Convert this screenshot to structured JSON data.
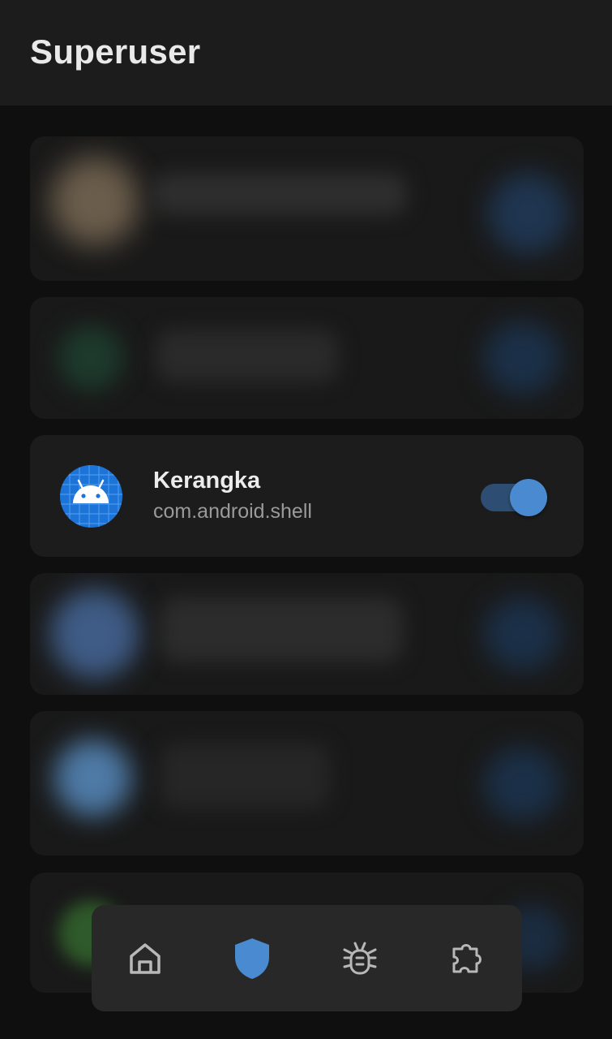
{
  "app_bar": {
    "title": "Superuser"
  },
  "superuser_list": {
    "visible_item": {
      "name": "Kerangka",
      "package": "com.android.shell",
      "icon": "android-icon",
      "granted": true
    }
  },
  "bottom_nav": {
    "items": [
      {
        "icon": "home-icon",
        "selected": false
      },
      {
        "icon": "shield-icon",
        "selected": true
      },
      {
        "icon": "bug-icon",
        "selected": false
      },
      {
        "icon": "puzzle-icon",
        "selected": false
      }
    ]
  },
  "colors": {
    "background": "#0f0f0f",
    "app_bar": "#1c1c1c",
    "card": "#191919",
    "accent": "#4a8ad0",
    "switch_track": "#2d4e72",
    "nav_icon": "#b8b8b8",
    "title_text": "#e9e9e9",
    "secondary_text": "#9a9a9a"
  }
}
